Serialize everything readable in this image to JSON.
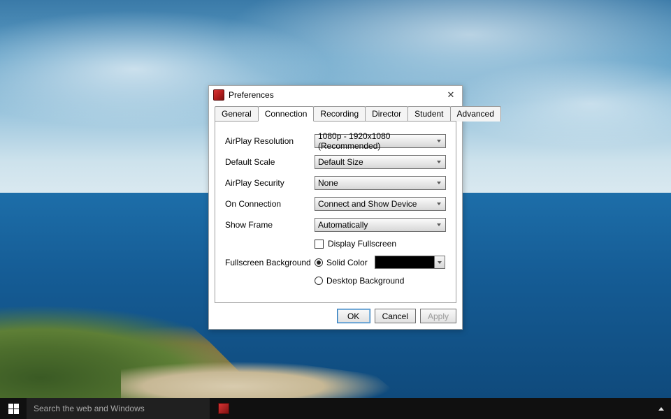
{
  "dialog": {
    "title": "Preferences",
    "tabs": [
      "General",
      "Connection",
      "Recording",
      "Director",
      "Student",
      "Advanced"
    ],
    "active_tab": "Connection",
    "fields": {
      "airplay_resolution": {
        "label": "AirPlay Resolution",
        "value": "1080p - 1920x1080 (Recommended)"
      },
      "default_scale": {
        "label": "Default Scale",
        "value": "Default Size"
      },
      "airplay_security": {
        "label": "AirPlay Security",
        "value": "None"
      },
      "on_connection": {
        "label": "On Connection",
        "value": "Connect and Show Device"
      },
      "show_frame": {
        "label": "Show Frame",
        "value": "Automatically"
      },
      "display_fullscreen": {
        "label": "Display Fullscreen",
        "checked": false
      },
      "fullscreen_background": {
        "label": "Fullscreen Background",
        "options": {
          "solid_color": "Solid Color",
          "desktop_background": "Desktop Background"
        },
        "selected": "solid_color",
        "color": "#000000"
      }
    },
    "buttons": {
      "ok": "OK",
      "cancel": "Cancel",
      "apply": "Apply"
    }
  },
  "taskbar": {
    "search_placeholder": "Search the web and Windows"
  }
}
